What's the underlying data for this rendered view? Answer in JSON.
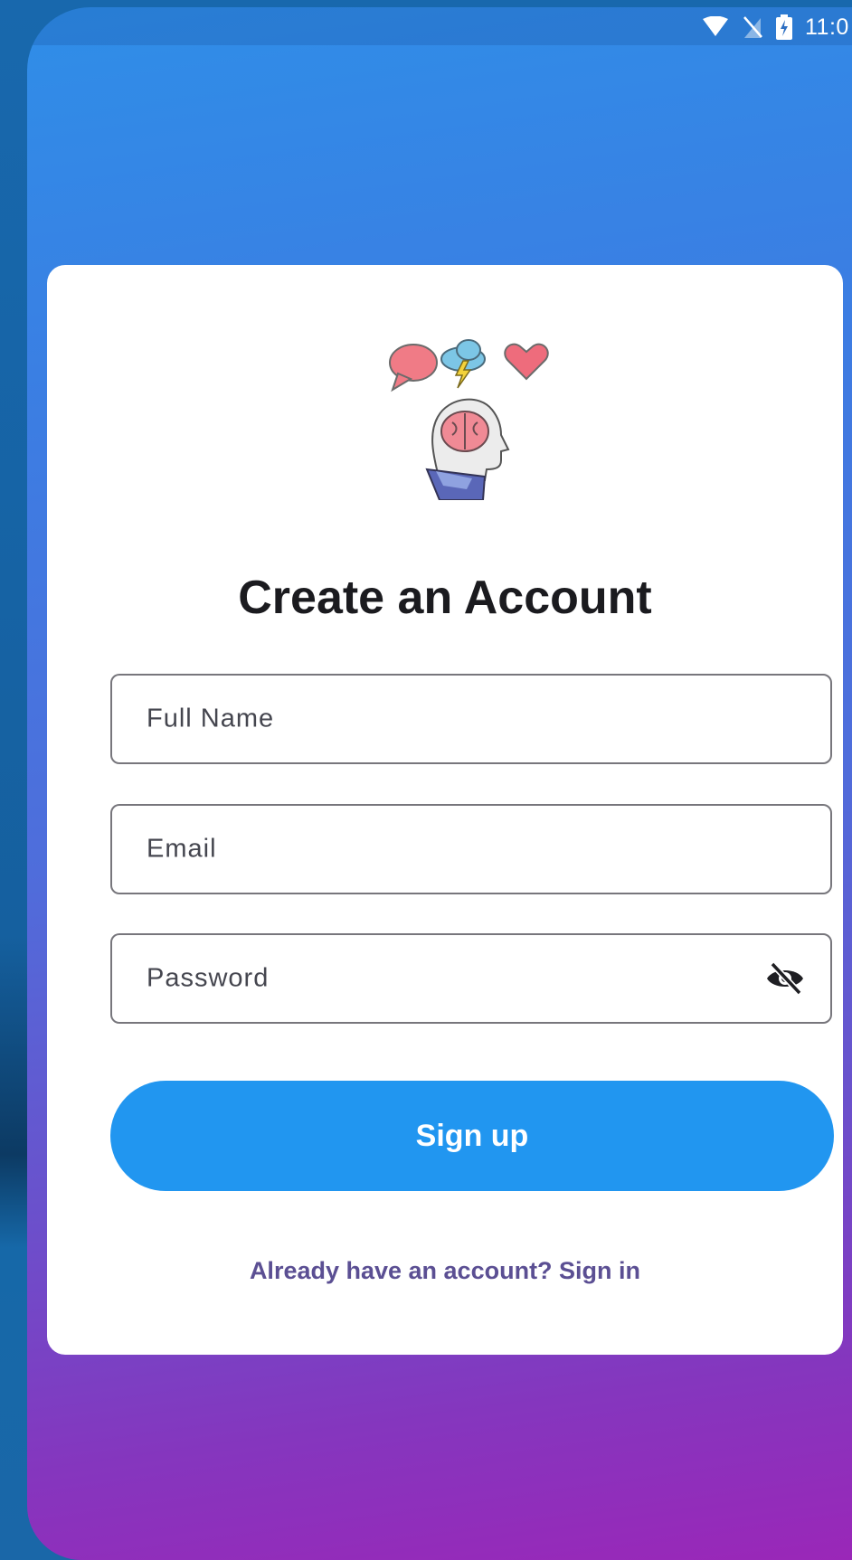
{
  "status_bar": {
    "time": "11:0",
    "icons": [
      "wifi-icon",
      "no-sim-icon",
      "battery-charging-icon"
    ]
  },
  "logo": {
    "icons": [
      "speech-bubble-icon",
      "storm-cloud-icon",
      "heart-icon",
      "head-with-brain-icon"
    ]
  },
  "form": {
    "title": "Create an Account",
    "full_name_label": "Full Name",
    "email_label": "Email",
    "password_label": "Password",
    "password_visibility_icon": "eye-off-icon",
    "signup_label": "Sign up",
    "signin_link": "Already have an account? Sign in"
  },
  "colors": {
    "gradient_top": "#2f8ee8",
    "gradient_bottom": "#9a27b8",
    "button": "#2196f0",
    "link": "#5b4f93",
    "title": "#1b1b1f"
  }
}
